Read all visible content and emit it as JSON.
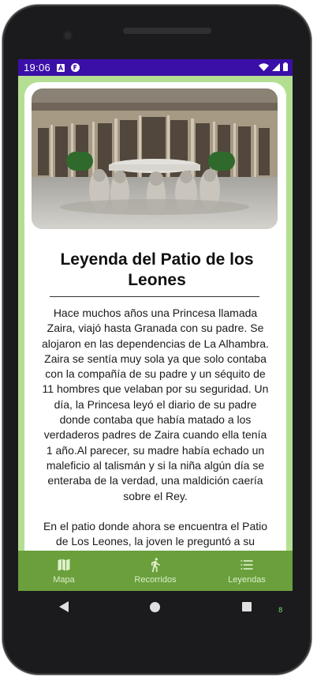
{
  "status_bar": {
    "time": "19:06",
    "icons": [
      "sim-a-icon",
      "app-notification-icon",
      "wifi-icon",
      "signal-icon",
      "battery-icon"
    ]
  },
  "article": {
    "image_alt": "Patio de los Leones",
    "title": "Leyenda del Patio de los Leones",
    "paragraphs": [
      "Hace muchos años una Princesa llamada Zaira, viajó hasta Granada con su padre. Se alojaron en las dependencias de La Alhambra. Zaira se sentía muy sola ya que solo contaba con la compañía de su padre y un séquito de 11 hombres que velaban por su seguridad. Un día, la Princesa leyó el diario de su padre donde contaba que había matado a los verdaderos padres de Zaira cuando ella tenía 1 año.Al parecer, su madre había echado un maleficio al talismán y si la niña algún día se enteraba de la verdad, una maldición caería sobre el Rey.",
      "En el patio donde ahora se encuentra el Patio de Los Leones, la joven le preguntó a su padre si lo que había leído era cierto"
    ]
  },
  "bottom_nav": {
    "items": [
      {
        "label": "Mapa",
        "icon": "map-icon"
      },
      {
        "label": "Recorridos",
        "icon": "walking-icon"
      },
      {
        "label": "Leyendas",
        "icon": "list-icon"
      }
    ]
  },
  "colors": {
    "status_bar": "#3a0fa8",
    "background": "#b4df92",
    "bottom_nav": "#6a9f3c",
    "nav_label": "#dcefc9"
  },
  "device": {
    "corner_label": "8"
  }
}
